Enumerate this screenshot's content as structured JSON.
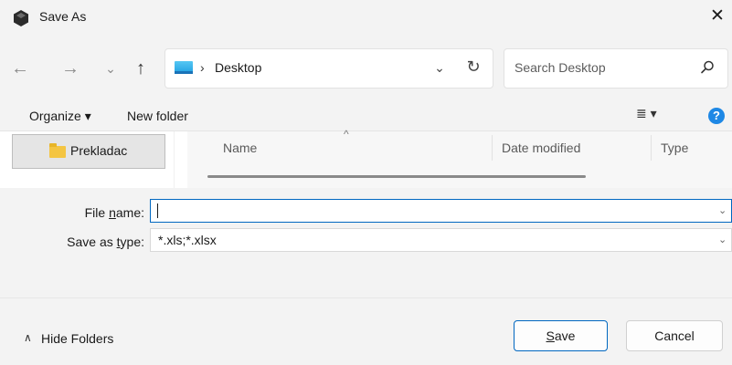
{
  "window": {
    "title": "Save As",
    "close_glyph": "✕"
  },
  "nav": {
    "back_glyph": "←",
    "forward_glyph": "→",
    "recent_glyph": "⌄",
    "up_glyph": "↑"
  },
  "address": {
    "separator": "›",
    "location": "Desktop",
    "dropdown_glyph": "⌄",
    "refresh_glyph": "↻"
  },
  "search": {
    "placeholder": "Search Desktop"
  },
  "toolbar": {
    "organize_label": "Organize ▾",
    "new_folder_label": "New folder",
    "view_glyph": "≣  ▾",
    "help_glyph": "?"
  },
  "sidebar": {
    "items": [
      {
        "label": "Prekladac"
      }
    ]
  },
  "file_list": {
    "sort_caret": "^",
    "columns": [
      "Name",
      "Date modified",
      "Type"
    ]
  },
  "form": {
    "file_name_label_pre": "File ",
    "file_name_label_ul": "n",
    "file_name_label_post": "ame:",
    "file_name_value": "",
    "save_type_label_pre": "Save as ",
    "save_type_label_ul": "t",
    "save_type_label_post": "ype:",
    "save_type_value": "*.xls;*.xlsx",
    "chevron_glyph": "⌄"
  },
  "footer": {
    "hide_caret": "∧",
    "hide_folders_label": "Hide Folders",
    "save_label_ul": "S",
    "save_label_rest": "ave",
    "cancel_label": "Cancel"
  },
  "colors": {
    "accent": "#0067c0",
    "help_blue": "#1e88e5",
    "folder_yellow": "#f4c542",
    "chrome_bg": "#f3f3f3"
  }
}
